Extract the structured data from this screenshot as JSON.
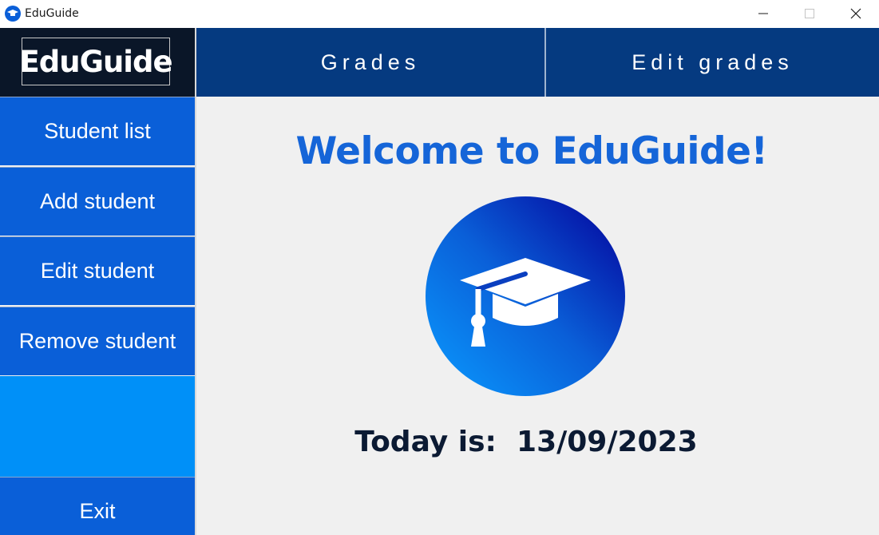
{
  "window": {
    "title": "EduGuide",
    "controls": {
      "minimize_icon": "minimize-icon",
      "maximize_icon": "maximize-icon",
      "close_icon": "close-icon"
    }
  },
  "sidebar": {
    "logo": "EduGuide",
    "items": [
      {
        "label": "Student list"
      },
      {
        "label": "Add student"
      },
      {
        "label": "Edit student"
      },
      {
        "label": "Remove student"
      }
    ],
    "exit_label": "Exit"
  },
  "topbar": {
    "tabs": [
      {
        "label": "Grades"
      },
      {
        "label": "Edit grades"
      }
    ]
  },
  "main": {
    "welcome": "Welcome to EduGuide!",
    "emblem_icon": "graduation-cap-icon",
    "date_label": "Today is:",
    "date_value": "13/09/2023"
  },
  "colors": {
    "sidebar_button": "#0a5fd8",
    "sidebar_spacer": "#0090f8",
    "topbar": "#053a80",
    "logo_bg": "#0a1628",
    "welcome_text": "#1565d8",
    "date_text": "#0b1a33"
  }
}
